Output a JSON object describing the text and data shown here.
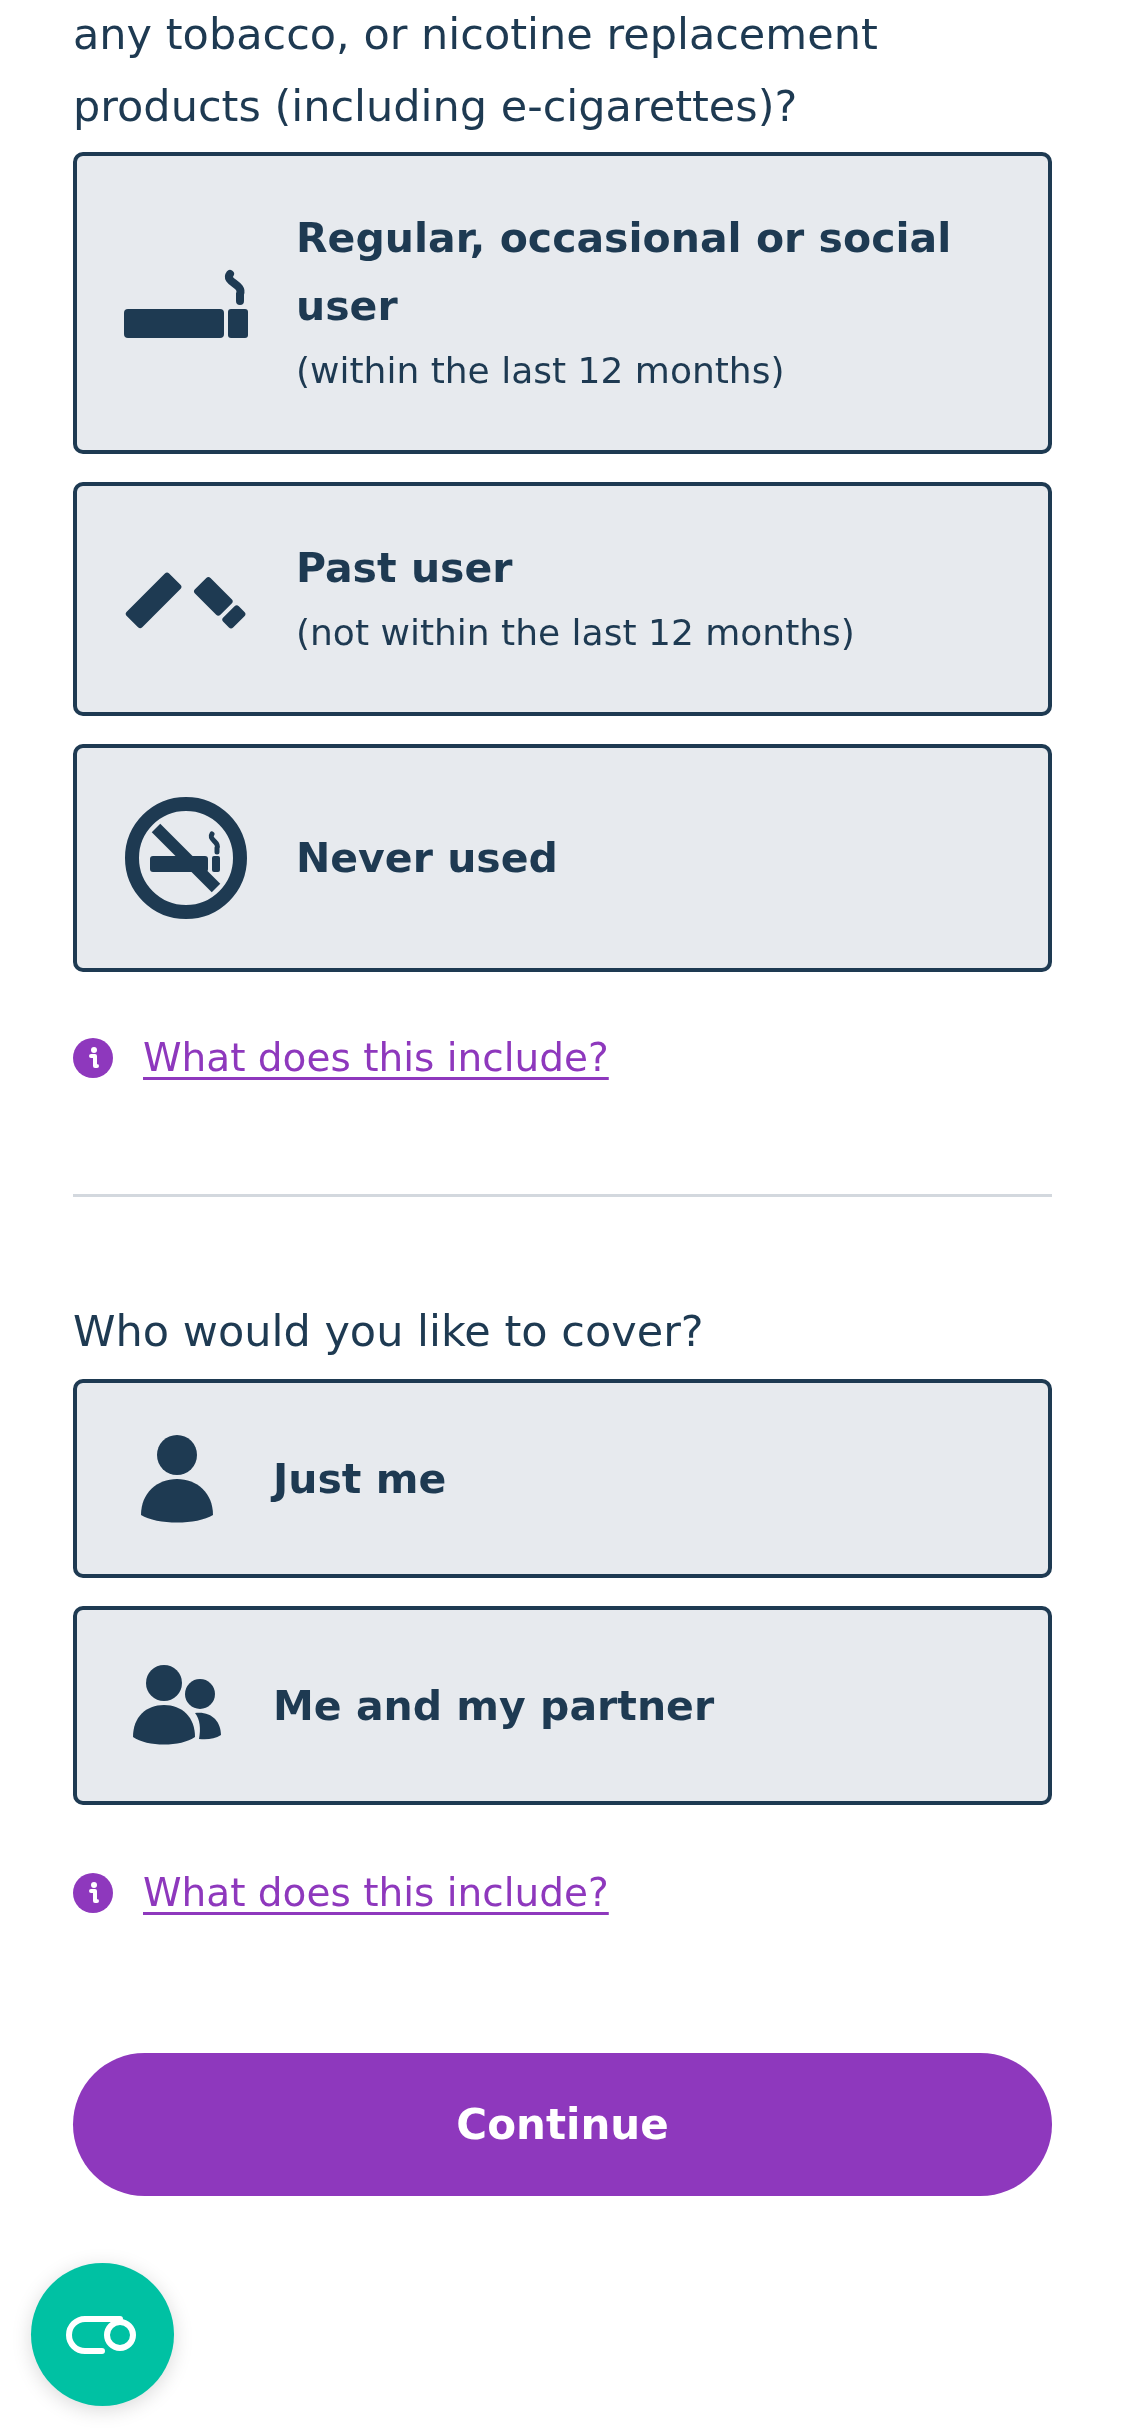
{
  "question": {
    "text": "any tobacco, or nicotine replacement products (including e-cigarettes)?"
  },
  "smoking_options": [
    {
      "title": "Regular, occasional or social user",
      "subtitle": "(within the last 12 months)",
      "selected": false
    },
    {
      "title": "Past user",
      "subtitle": "(not within the last 12 months)",
      "selected": false
    },
    {
      "title": "Never used",
      "selected": false
    }
  ],
  "smoking_info_link": "What does this include?",
  "cover_question": "Who would you like to cover?",
  "cover_options": [
    {
      "title": "Just me",
      "selected": false
    },
    {
      "title": "Me and my partner",
      "selected": false
    }
  ],
  "cover_info_link": "What does this include?",
  "continue_button": "Continue"
}
